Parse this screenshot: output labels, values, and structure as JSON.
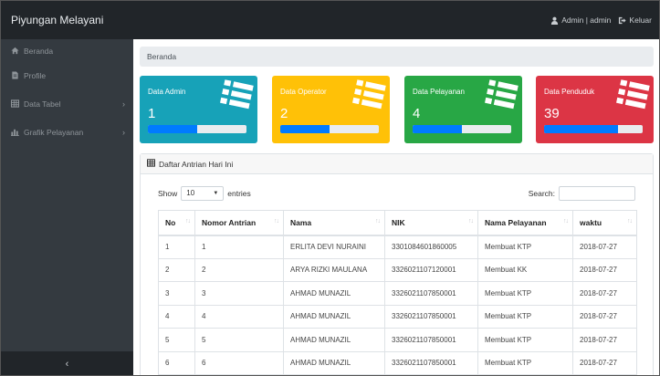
{
  "app": {
    "title": "Piyungan Melayani"
  },
  "user": {
    "label": "Admin | admin",
    "logout": "Keluar"
  },
  "sidebar": {
    "items": [
      {
        "label": "Beranda",
        "icon": "home-icon"
      },
      {
        "label": "Profile",
        "icon": "document-icon"
      },
      {
        "label": "Data Tabel",
        "icon": "table-icon"
      },
      {
        "label": "Grafik Pelayanan",
        "icon": "bar-chart-icon"
      }
    ],
    "toggle": "‹"
  },
  "breadcrumb": "Beranda",
  "cards": [
    {
      "title": "Data Admin",
      "count": "1",
      "color": "#17a2b8",
      "progress": 0.5
    },
    {
      "title": "Data Operator",
      "count": "2",
      "color": "#ffc107",
      "progress": 0.5
    },
    {
      "title": "Data Pelayanan",
      "count": "4",
      "color": "#28a745",
      "progress": 0.5
    },
    {
      "title": "Data Penduduk",
      "count": "39",
      "color": "#dc3545",
      "progress": 0.75
    }
  ],
  "panel": {
    "title": "Daftar Antrian Hari Ini"
  },
  "length_control": {
    "show": "Show",
    "value": "10",
    "entries": "entries"
  },
  "search": {
    "label": "Search:",
    "value": ""
  },
  "table": {
    "columns": [
      "No",
      "Nomor Antrian",
      "Nama",
      "NIK",
      "Nama Pelayanan",
      "waktu"
    ],
    "rows": [
      [
        "1",
        "1",
        "ERLITA DEVI NURAINI",
        "3301084601860005",
        "Membuat KTP",
        "2018-07-27"
      ],
      [
        "2",
        "2",
        "ARYA RIZKI MAULANA",
        "3326021107120001",
        "Membuat KK",
        "2018-07-27"
      ],
      [
        "3",
        "3",
        "AHMAD MUNAZIL",
        "3326021107850001",
        "Membuat KTP",
        "2018-07-27"
      ],
      [
        "4",
        "4",
        "AHMAD MUNAZIL",
        "3326021107850001",
        "Membuat KTP",
        "2018-07-27"
      ],
      [
        "5",
        "5",
        "AHMAD MUNAZIL",
        "3326021107850001",
        "Membuat KTP",
        "2018-07-27"
      ],
      [
        "6",
        "6",
        "AHMAD MUNAZIL",
        "3326021107850001",
        "Membuat KTP",
        "2018-07-27"
      ]
    ]
  }
}
